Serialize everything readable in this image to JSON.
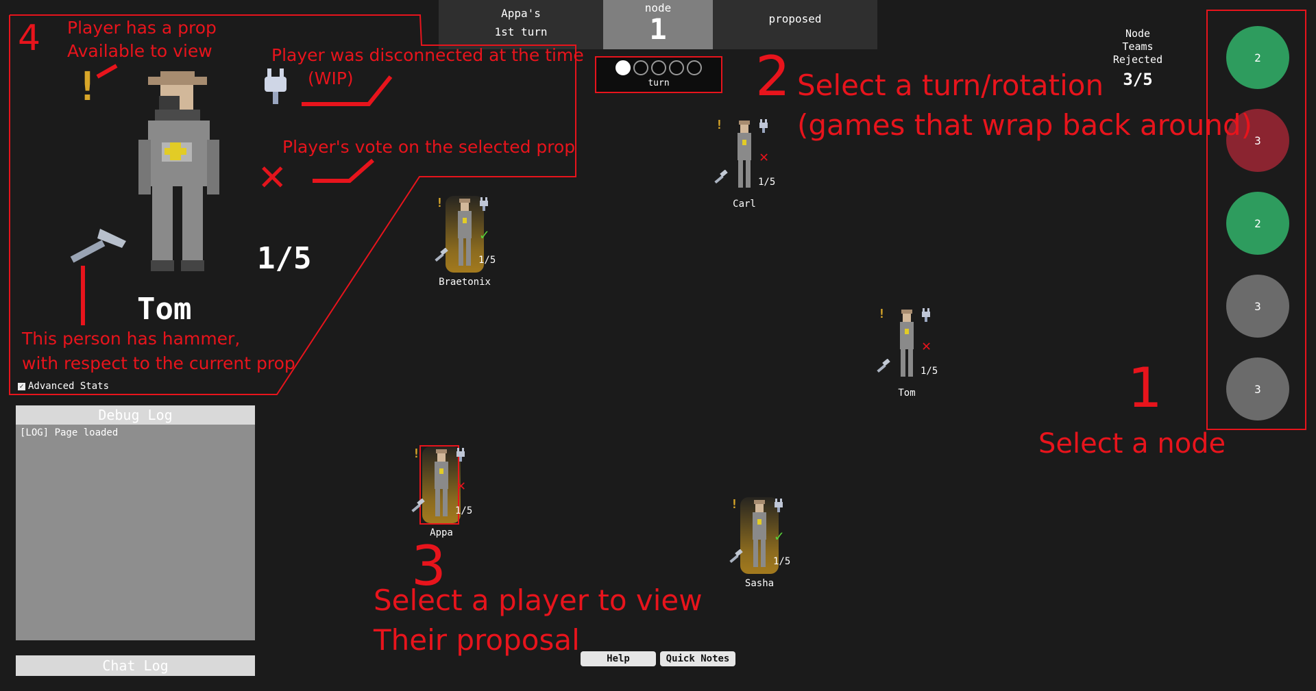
{
  "header": {
    "leader_name": "Appa's",
    "leader_turn": "1st turn",
    "node_label": "node",
    "node_number": "1",
    "status": "proposed",
    "turn_label": "turn",
    "turn_dots": 5,
    "active_dot": 1
  },
  "teams_rejected": {
    "label_line1": "Node",
    "label_line2": "Teams",
    "label_line3": "Rejected",
    "value": "3/5"
  },
  "nodes": [
    {
      "value": "2",
      "color": "#2e9c5e"
    },
    {
      "value": "3",
      "color": "#8b2430"
    },
    {
      "value": "2",
      "color": "#2e9c5e"
    },
    {
      "value": "3",
      "color": "#6b6b6b"
    },
    {
      "value": "3",
      "color": "#6b6b6b"
    }
  ],
  "players": [
    {
      "name": "Carl",
      "count": "1/5",
      "vote": "reject",
      "has_glow": false,
      "selected": false
    },
    {
      "name": "Braetonix",
      "count": "1/5",
      "vote": "approve",
      "has_glow": true,
      "selected": false
    },
    {
      "name": "Tom",
      "count": "1/5",
      "vote": "reject",
      "has_glow": false,
      "selected": false
    },
    {
      "name": "Appa",
      "count": "1/5",
      "vote": "reject",
      "has_glow": true,
      "selected": true
    },
    {
      "name": "Sasha",
      "count": "1/5",
      "vote": "approve",
      "has_glow": true,
      "selected": false
    }
  ],
  "detail": {
    "name": "Tom",
    "count": "1/5",
    "vote": "reject",
    "advanced_stats_label": "Advanced Stats"
  },
  "annotations": {
    "num1": "1",
    "num1_text": "Select a node",
    "num2": "2",
    "num2_text_line1": "Select a turn/rotation",
    "num2_text_line2": "(games that wrap back around)",
    "num3": "3",
    "num3_text_line1": "Select a player to view",
    "num3_text_line2": "Their proposal",
    "num4": "4",
    "prop_line1": "Player has a prop",
    "prop_line2": "Available to view",
    "disc_line1": "Player was disconnected at the time",
    "disc_line2": "(WIP)",
    "vote_text": "Player's vote on the selected prop",
    "hammer_line1": "This person has hammer,",
    "hammer_line2": "with respect to the current prop"
  },
  "debug_log": {
    "title": "Debug Log",
    "entry": "[LOG] Page loaded"
  },
  "chat_log": {
    "title": "Chat Log"
  },
  "buttons": {
    "help": "Help",
    "quick_notes": "Quick Notes"
  },
  "colors": {
    "annotation_red": "#e8141c",
    "approve_green": "#5ad13a",
    "reject_red": "#e3141c",
    "background": "#1b1b1b"
  }
}
